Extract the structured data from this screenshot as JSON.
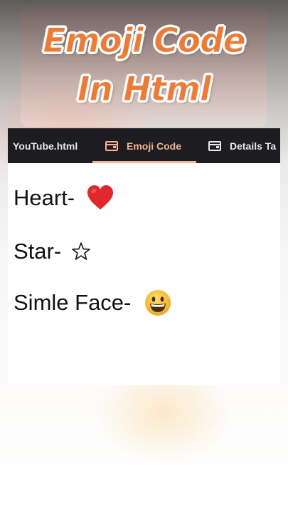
{
  "title": {
    "line1": "Emoji Code",
    "line2": "In Html",
    "color": "#f07a32"
  },
  "tabs": [
    {
      "label": "YouTube.html",
      "icon": "none",
      "active": false
    },
    {
      "label": "Emoji Code",
      "icon": "browser-window-icon",
      "active": true
    },
    {
      "label": "Details Ta",
      "icon": "browser-window-icon",
      "active": false
    }
  ],
  "colors": {
    "tabbar": "#1d1d21",
    "active_tab": "#f6b28f",
    "heart": "#e3262b",
    "smile": "#f5b829"
  },
  "content": [
    {
      "text": "Heart- ",
      "emoji": "heart-icon"
    },
    {
      "text": "Star- ",
      "emoji": "star-icon"
    },
    {
      "text": "Simle Face- ",
      "emoji": "grinning-face-icon"
    }
  ]
}
